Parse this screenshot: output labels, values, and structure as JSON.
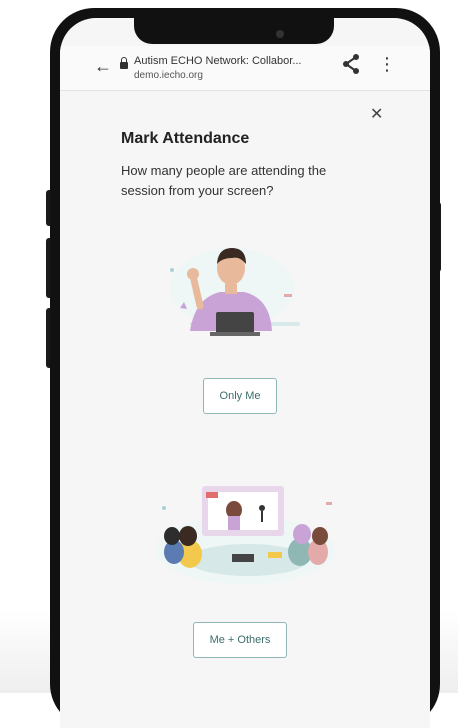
{
  "browser": {
    "site_title": "Autism ECHO Network: Collabor...",
    "domain": "demo.iecho.org"
  },
  "dialog": {
    "title": "Mark Attendance",
    "question": "How many people are attending the session from your screen?",
    "options": [
      {
        "label": "Only Me"
      },
      {
        "label": "Me + Others"
      }
    ]
  },
  "colors": {
    "button_border": "#8fb8b5",
    "button_text": "#3b6e6c",
    "accent_purple": "#c9a3d6"
  },
  "icons": [
    "back-arrow-icon",
    "lock-icon",
    "share-icon",
    "more-vert-icon",
    "close-icon"
  ]
}
